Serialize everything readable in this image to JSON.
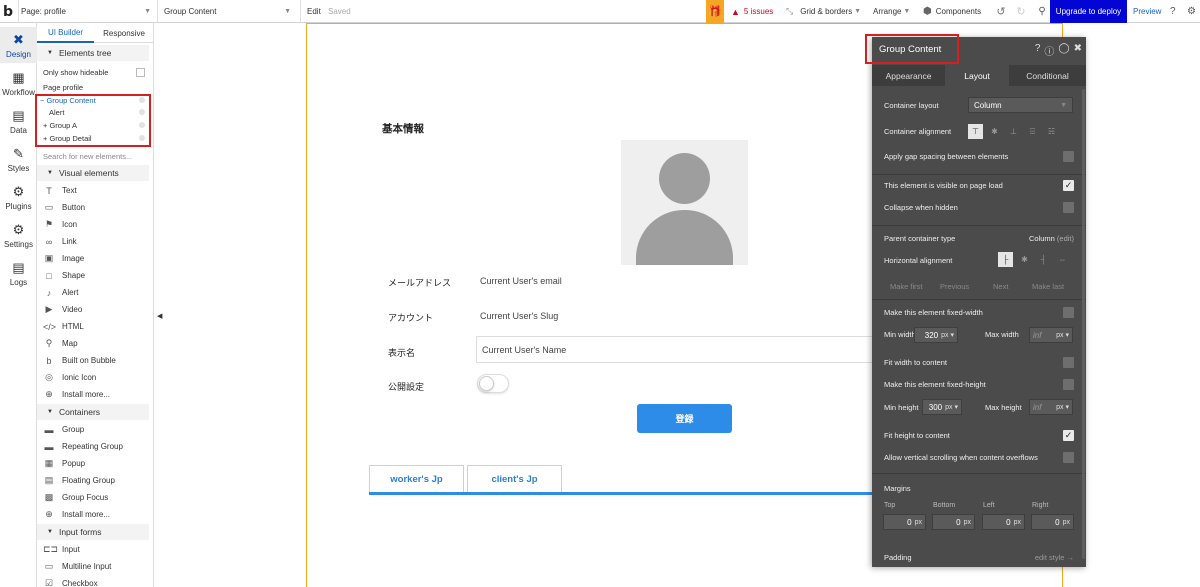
{
  "topbar": {
    "logo": "b",
    "page_select": "Page: profile",
    "element_select": "Group Content",
    "edit": "Edit",
    "saved": "Saved",
    "issues": "5 issues",
    "grid_borders": "Grid & borders",
    "arrange": "Arrange",
    "components": "Components",
    "deploy": "Upgrade to deploy",
    "preview": "Preview"
  },
  "rail": [
    {
      "label": "Design",
      "icon": "design-icon",
      "active": true
    },
    {
      "label": "Workflow",
      "icon": "workflow-icon"
    },
    {
      "label": "Data",
      "icon": "database-icon"
    },
    {
      "label": "Styles",
      "icon": "brush-icon"
    },
    {
      "label": "Plugins",
      "icon": "plug-icon"
    },
    {
      "label": "Settings",
      "icon": "gear-icon"
    },
    {
      "label": "Logs",
      "icon": "document-icon"
    }
  ],
  "left_panel": {
    "tabs": [
      "UI Builder",
      "Responsive"
    ],
    "elements_tree": "Elements tree",
    "only_hideable": "Only show hideable",
    "page_root": "Page profile",
    "tree": [
      {
        "label": "− Group Content"
      },
      {
        "label": "Alert"
      },
      {
        "label": "+ Group A"
      },
      {
        "label": "+ Group Detail"
      }
    ],
    "search_placeholder": "Search for new elements...",
    "visual_header": "Visual elements",
    "visual_items": [
      {
        "label": "Text",
        "icon": "text-icon"
      },
      {
        "label": "Button",
        "icon": "button-icon"
      },
      {
        "label": "Icon",
        "icon": "flag-icon"
      },
      {
        "label": "Link",
        "icon": "link-icon"
      },
      {
        "label": "Image",
        "icon": "image-icon"
      },
      {
        "label": "Shape",
        "icon": "square-icon"
      },
      {
        "label": "Alert",
        "icon": "bell-icon"
      },
      {
        "label": "Video",
        "icon": "video-icon"
      },
      {
        "label": "HTML",
        "icon": "code-icon"
      },
      {
        "label": "Map",
        "icon": "map-pin-icon"
      },
      {
        "label": "Built on Bubble",
        "icon": "bubble-logo-icon"
      },
      {
        "label": "Ionic Icon",
        "icon": "ionic-icon"
      },
      {
        "label": "Install more...",
        "icon": "plus-circle-icon"
      }
    ],
    "containers_header": "Containers",
    "container_items": [
      {
        "label": "Group",
        "icon": "folder-icon"
      },
      {
        "label": "Repeating Group",
        "icon": "folder-icon"
      },
      {
        "label": "Popup",
        "icon": "popup-icon"
      },
      {
        "label": "Floating Group",
        "icon": "floating-group-icon"
      },
      {
        "label": "Group Focus",
        "icon": "focus-icon"
      },
      {
        "label": "Install more...",
        "icon": "plus-circle-icon"
      }
    ],
    "input_header": "Input forms",
    "input_items": [
      {
        "label": "Input",
        "icon": "input-icon"
      },
      {
        "label": "Multiline Input",
        "icon": "multiline-icon"
      },
      {
        "label": "Checkbox",
        "icon": "checkbox-icon"
      }
    ]
  },
  "page": {
    "section_title": "基本情報",
    "email_label": "メールアドレス",
    "email_value": "Current User's email",
    "account_label": "アカウント",
    "account_value": "Current User's Slug",
    "display_label": "表示名",
    "name_value": "Current User's Name",
    "public_label": "公開設定",
    "register_button": "登録",
    "tabs": [
      "worker's Jp",
      "client's Jp"
    ]
  },
  "props": {
    "title": "Group Content",
    "tabs": [
      "Appearance",
      "Layout",
      "Conditional"
    ],
    "container_layout_label": "Container layout",
    "container_layout_value": "Column",
    "container_alignment_label": "Container alignment",
    "gap_spacing": "Apply gap spacing between elements",
    "visible_on_load": "This element is visible on page load",
    "collapse_hidden": "Collapse when hidden",
    "parent_type_label": "Parent container type",
    "parent_type_value": "Column",
    "parent_type_edit": "(edit)",
    "horizontal_alignment": "Horizontal alignment",
    "nav": [
      "Make first",
      "Previous",
      "Next",
      "Make last"
    ],
    "fixed_width": "Make this element fixed-width",
    "min_width_label": "Min width",
    "min_width_value": "320",
    "max_width_label": "Max width",
    "max_width_value": "inf",
    "unit_px": "px",
    "fit_width": "Fit width to content",
    "fixed_height": "Make this element fixed-height",
    "min_height_label": "Min height",
    "min_height_value": "300",
    "max_height_label": "Max height",
    "max_height_value": "inf",
    "fit_height": "Fit height to content",
    "vertical_scroll": "Allow vertical scrolling when content overflows",
    "margins_label": "Margins",
    "margin_captions": [
      "Top",
      "Bottom",
      "Left",
      "Right"
    ],
    "margin_values": [
      "0",
      "0",
      "0",
      "0"
    ],
    "padding_label": "Padding",
    "edit_style": "edit style →",
    "checks": {
      "gap": false,
      "visible": true,
      "collapse": false,
      "fixed_width": false,
      "fit_width": false,
      "fixed_height": false,
      "fit_height": true,
      "scroll": false
    }
  },
  "colors": {
    "accent": "#1565c0",
    "deploy": "#0205d3",
    "button": "#2d8ce7",
    "panel": "#4b4b4b",
    "highlight": "#d42020",
    "frame": "#f5a623"
  }
}
